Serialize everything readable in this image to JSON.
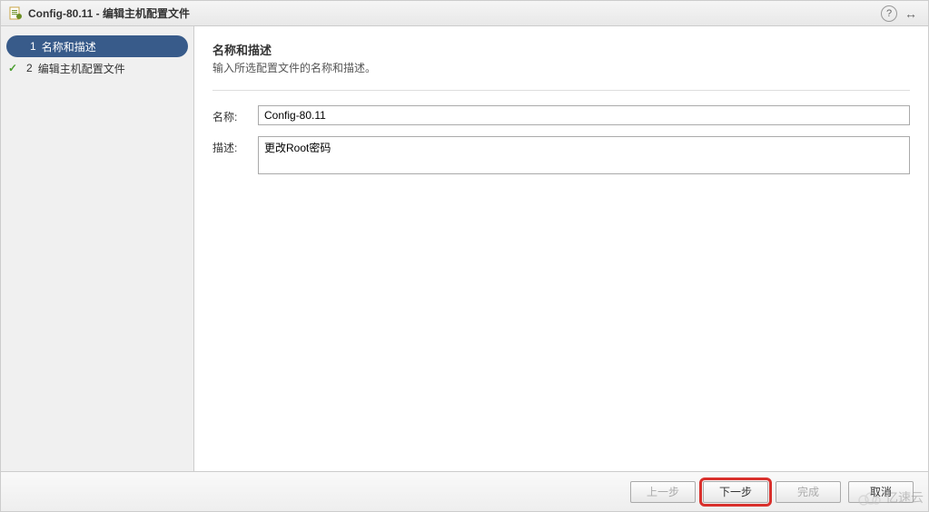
{
  "titlebar": {
    "title": "Config-80.11 - 编辑主机配置文件",
    "help_label": "?"
  },
  "sidebar": {
    "steps": [
      {
        "num": "1",
        "label": "名称和描述"
      },
      {
        "num": "2",
        "label": "编辑主机配置文件"
      }
    ]
  },
  "content": {
    "title": "名称和描述",
    "subtitle": "输入所选配置文件的名称和描述。",
    "name_label": "名称:",
    "name_value": "Config-80.11",
    "desc_label": "描述:",
    "desc_value": "更改Root密码"
  },
  "footer": {
    "back": "上一步",
    "next": "下一步",
    "finish": "完成",
    "cancel": "取消"
  },
  "watermark": {
    "text": "亿速云"
  }
}
